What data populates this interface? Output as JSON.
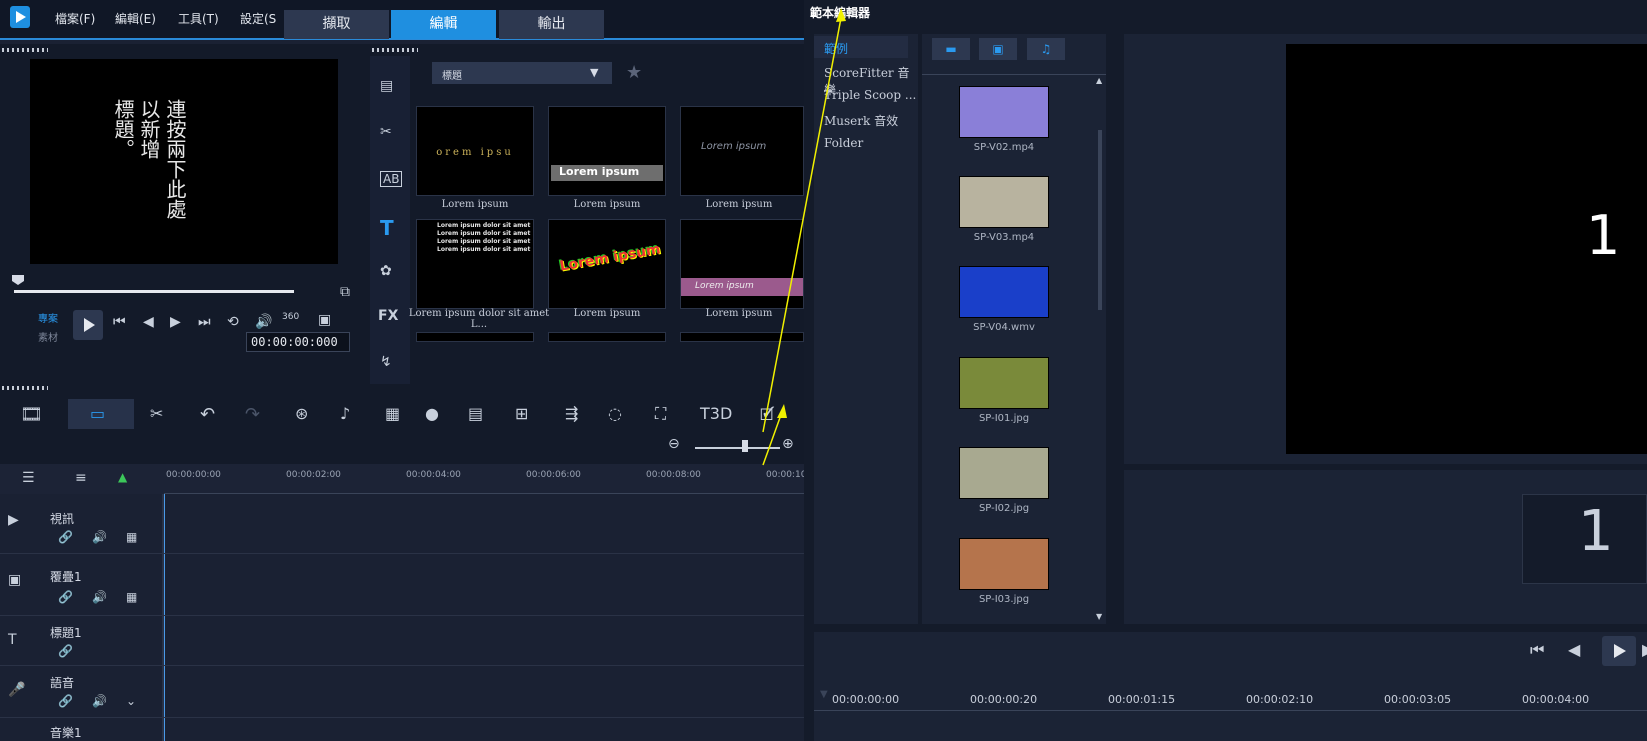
{
  "menu": [
    "檔案(F)",
    "編輯(E)",
    "工具(T)",
    "設定(S"
  ],
  "tabs": [
    "擷取",
    "編輯",
    "輸出"
  ],
  "preview": {
    "text_lines": [
      "連按兩下此處",
      "以新增",
      "標題。"
    ],
    "mode_project": "專案",
    "mode_clip": "素材",
    "timecode": "00:00:00:000",
    "vr": "360"
  },
  "library": {
    "category": "標題",
    "side_icons": [
      "film-icon",
      "scene-icon",
      "ab-transition-icon",
      "title-icon",
      "graphics-icon",
      "fx-icon",
      "path-icon"
    ],
    "items": [
      {
        "caption": "Lorem ipsum",
        "art": "orem ipsu"
      },
      {
        "caption": "Lorem ipsum",
        "art": "Lorem ipsum"
      },
      {
        "caption": "Lorem ipsum",
        "art": "Lorem ipsum"
      },
      {
        "caption": "Lorem ipsum dolor sit amet L...",
        "art": "Lorem ipsum dolor sit amet"
      },
      {
        "caption": "Lorem ipsum",
        "art": "Lorem ipsum"
      },
      {
        "caption": "Lorem ipsum",
        "art": "Lorem ipsum"
      }
    ]
  },
  "timeline": {
    "ruler": [
      "00:00:00:00",
      "00:00:02:00",
      "00:00:04:00",
      "00:00:06:00",
      "00:00:08:00",
      "00:00:10"
    ],
    "tracks": [
      {
        "name": "視訊"
      },
      {
        "name": "覆疊1"
      },
      {
        "name": "標題1"
      },
      {
        "name": "語音"
      },
      {
        "name": "音樂1"
      }
    ],
    "title_3d": "T3D"
  },
  "editor": {
    "title": "範本編輯器",
    "folders": [
      "範例",
      "ScoreFitter 音樂",
      "Triple Scoop ...",
      "Muserk 音效",
      "Folder"
    ],
    "media": [
      {
        "name": "SP-V02.mp4",
        "color": "#8a7fd8"
      },
      {
        "name": "SP-V03.mp4",
        "color": "#b8b39f"
      },
      {
        "name": "SP-V04.wmv",
        "color": "#1a3fc9"
      },
      {
        "name": "SP-I01.jpg",
        "color": "#7a8a3a"
      },
      {
        "name": "SP-I02.jpg",
        "color": "#a8a990"
      },
      {
        "name": "SP-I03.jpg",
        "color": "#b5744c"
      }
    ],
    "preview_number": "1",
    "track_number": "1",
    "ruler": [
      "00:00:00:00",
      "00:00:00:20",
      "00:00:01:15",
      "00:00:02:10",
      "00:00:03:05",
      "00:00:04:00"
    ]
  },
  "colors": {
    "accent": "#1f8fe0",
    "annotation": "#f0f000"
  }
}
